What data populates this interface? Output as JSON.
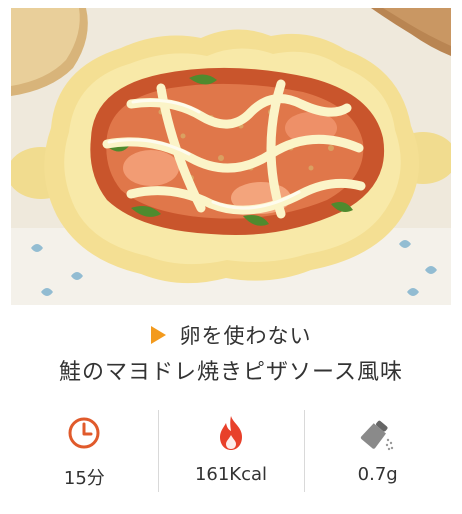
{
  "recipe": {
    "subtitle": "卵を使わない",
    "title": "鮭のマヨドレ焼きピザソース風味",
    "photo_icon": "gratin-photo"
  },
  "stats": {
    "time": {
      "icon": "clock-icon",
      "value": "15分"
    },
    "calories": {
      "icon": "flame-icon",
      "value": "161Kcal"
    },
    "salt": {
      "icon": "salt-shaker-icon",
      "value": "0.7g"
    }
  },
  "colors": {
    "accent": "#f39a1d",
    "clock": "#e05a2b",
    "flame": "#e8402a",
    "text": "#333333",
    "divider": "#d9d9d9"
  }
}
